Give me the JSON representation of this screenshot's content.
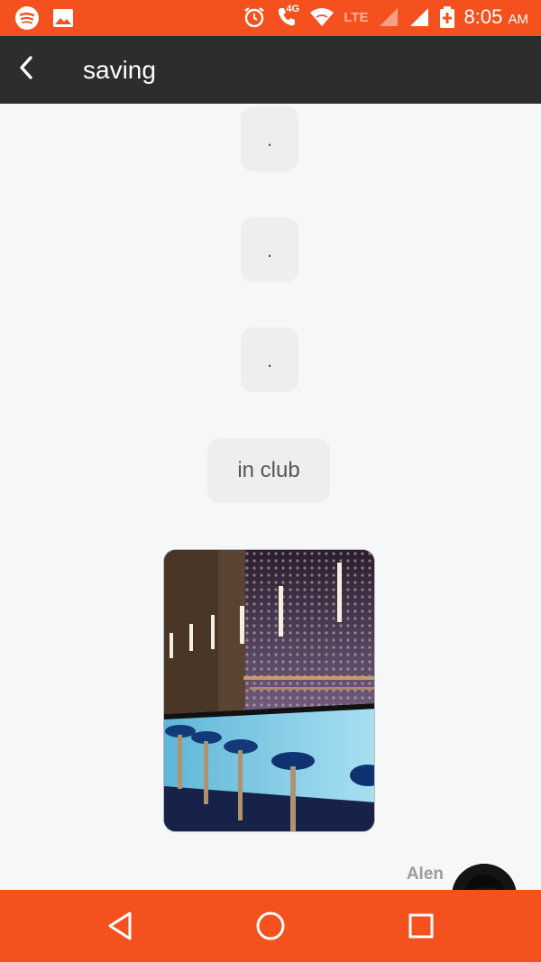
{
  "status_bar": {
    "time": "8:05",
    "ampm": "AM",
    "network_type": "4G",
    "lte_label": "LTE",
    "icons": [
      "spotify-icon",
      "gallery-icon",
      "alarm-icon",
      "call-icon",
      "wifi-icon",
      "signal-icon",
      "battery-icon"
    ]
  },
  "header": {
    "title": "saving",
    "back_icon": "back-arrow-icon"
  },
  "messages": [
    {
      "type": "text",
      "text": "."
    },
    {
      "type": "text",
      "text": "."
    },
    {
      "type": "text",
      "text": "."
    },
    {
      "type": "text",
      "text": "in club"
    },
    {
      "type": "image",
      "description_icon": "photo-bar-image"
    }
  ],
  "sender": {
    "name": "Alen"
  },
  "nav": {
    "buttons": [
      "back-nav-icon",
      "home-nav-icon",
      "recents-nav-icon"
    ]
  },
  "colors": {
    "accent": "#f4511e",
    "header_bg": "#2d2d2d",
    "chat_bg": "#f6f7f9",
    "bubble_bg": "#eeeeee"
  }
}
